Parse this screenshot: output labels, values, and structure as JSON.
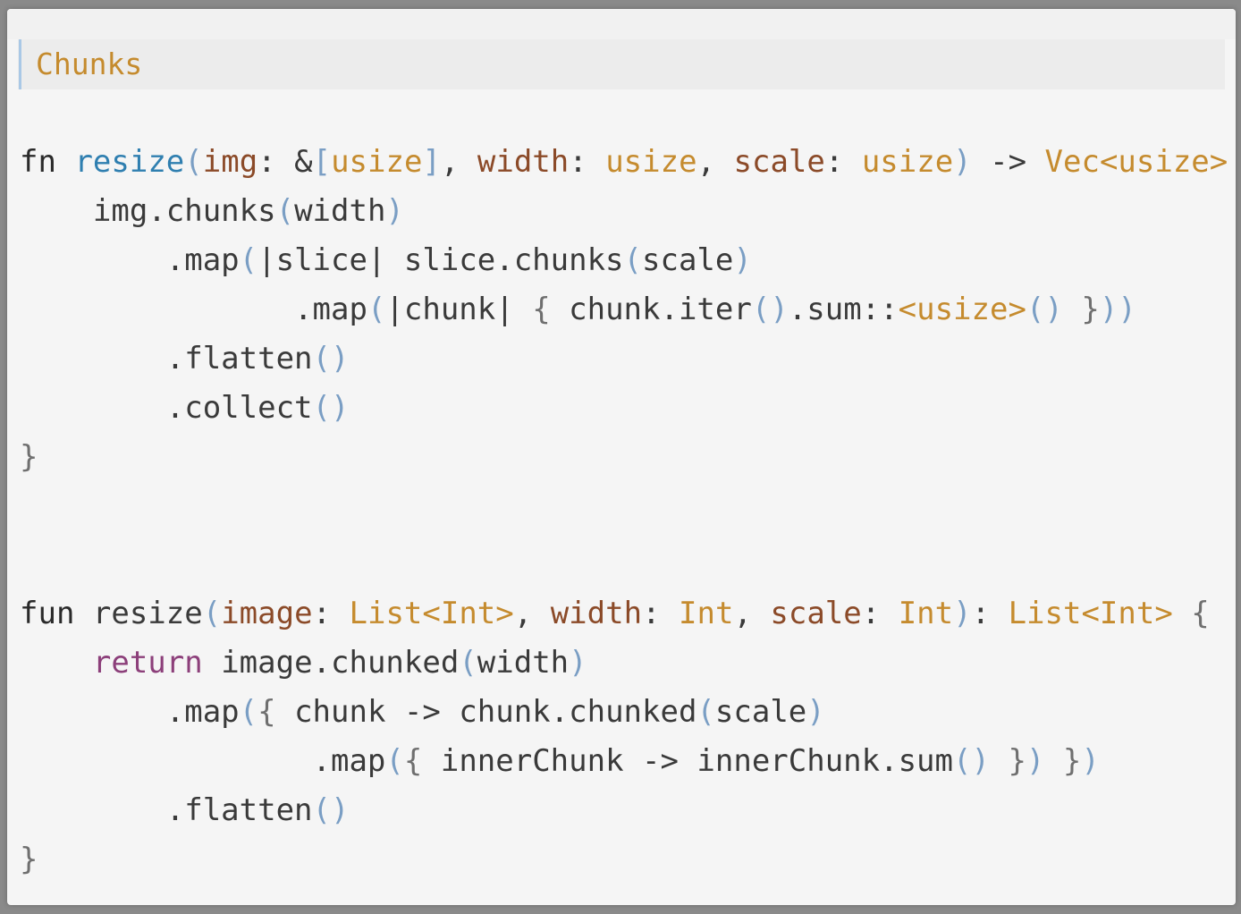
{
  "slide": {
    "title": "Chunks"
  },
  "rust_code": {
    "lines": [
      {
        "tokens": [
          {
            "t": "fn",
            "c": "kw"
          },
          {
            "t": " "
          },
          {
            "t": "resize",
            "c": "fnn"
          },
          {
            "t": "(",
            "c": "pa"
          },
          {
            "t": "img",
            "c": "pr"
          },
          {
            "t": ": &"
          },
          {
            "t": "[",
            "c": "pa"
          },
          {
            "t": "usize",
            "c": "ty"
          },
          {
            "t": "]",
            "c": "pa"
          },
          {
            "t": ", "
          },
          {
            "t": "width",
            "c": "pr"
          },
          {
            "t": ": "
          },
          {
            "t": "usize",
            "c": "ty"
          },
          {
            "t": ", "
          },
          {
            "t": "scale",
            "c": "pr"
          },
          {
            "t": ": "
          },
          {
            "t": "usize",
            "c": "ty"
          },
          {
            "t": ")",
            "c": "pa"
          },
          {
            "t": " -> "
          },
          {
            "t": "Vec<usize>",
            "c": "ty"
          },
          {
            "t": " "
          },
          {
            "t": "{",
            "c": "br"
          }
        ]
      },
      {
        "tokens": [
          {
            "t": "    img.chunks"
          },
          {
            "t": "(",
            "c": "pa"
          },
          {
            "t": "width"
          },
          {
            "t": ")",
            "c": "pa"
          }
        ]
      },
      {
        "tokens": [
          {
            "t": "        .map"
          },
          {
            "t": "(",
            "c": "pa"
          },
          {
            "t": "|slice| slice.chunks"
          },
          {
            "t": "(",
            "c": "pa"
          },
          {
            "t": "scale"
          },
          {
            "t": ")",
            "c": "pa"
          }
        ]
      },
      {
        "tokens": [
          {
            "t": "               .map"
          },
          {
            "t": "(",
            "c": "pa"
          },
          {
            "t": "|chunk| "
          },
          {
            "t": "{",
            "c": "br"
          },
          {
            "t": " chunk.iter"
          },
          {
            "t": "()",
            "c": "pa"
          },
          {
            "t": ".sum::"
          },
          {
            "t": "<usize>",
            "c": "ty"
          },
          {
            "t": "()",
            "c": "pa"
          },
          {
            "t": " "
          },
          {
            "t": "}",
            "c": "br"
          },
          {
            "t": "))",
            "c": "pa"
          }
        ]
      },
      {
        "tokens": [
          {
            "t": "        .flatten"
          },
          {
            "t": "()",
            "c": "pa"
          }
        ]
      },
      {
        "tokens": [
          {
            "t": "        .collect"
          },
          {
            "t": "()",
            "c": "pa"
          }
        ]
      },
      {
        "tokens": [
          {
            "t": "}",
            "c": "br"
          }
        ]
      }
    ]
  },
  "kotlin_code": {
    "lines": [
      {
        "tokens": [
          {
            "t": "fun",
            "c": "kw"
          },
          {
            "t": " resize"
          },
          {
            "t": "(",
            "c": "pa"
          },
          {
            "t": "image",
            "c": "pr"
          },
          {
            "t": ": "
          },
          {
            "t": "List<Int>",
            "c": "ty"
          },
          {
            "t": ", "
          },
          {
            "t": "width",
            "c": "pr"
          },
          {
            "t": ": "
          },
          {
            "t": "Int",
            "c": "ty"
          },
          {
            "t": ", "
          },
          {
            "t": "scale",
            "c": "pr"
          },
          {
            "t": ": "
          },
          {
            "t": "Int",
            "c": "ty"
          },
          {
            "t": ")",
            "c": "pa"
          },
          {
            "t": ": "
          },
          {
            "t": "List<Int>",
            "c": "ty"
          },
          {
            "t": " "
          },
          {
            "t": "{",
            "c": "br"
          }
        ]
      },
      {
        "tokens": [
          {
            "t": "    "
          },
          {
            "t": "return",
            "c": "ret"
          },
          {
            "t": " image.chunked"
          },
          {
            "t": "(",
            "c": "pa"
          },
          {
            "t": "width"
          },
          {
            "t": ")",
            "c": "pa"
          }
        ]
      },
      {
        "tokens": [
          {
            "t": "        .map"
          },
          {
            "t": "(",
            "c": "pa"
          },
          {
            "t": "{",
            "c": "br"
          },
          {
            "t": " chunk -> chunk.chunked"
          },
          {
            "t": "(",
            "c": "pa"
          },
          {
            "t": "scale"
          },
          {
            "t": ")",
            "c": "pa"
          }
        ]
      },
      {
        "tokens": [
          {
            "t": "                .map"
          },
          {
            "t": "(",
            "c": "pa"
          },
          {
            "t": "{",
            "c": "br"
          },
          {
            "t": " innerChunk -> innerChunk.sum"
          },
          {
            "t": "()",
            "c": "pa"
          },
          {
            "t": " "
          },
          {
            "t": "}",
            "c": "br"
          },
          {
            "t": ")",
            "c": "pa"
          },
          {
            "t": " "
          },
          {
            "t": "}",
            "c": "br"
          },
          {
            "t": ")",
            "c": "pa"
          }
        ]
      },
      {
        "tokens": [
          {
            "t": "        .flatten"
          },
          {
            "t": "()",
            "c": "pa"
          }
        ]
      },
      {
        "tokens": [
          {
            "t": "}",
            "c": "br"
          }
        ]
      }
    ]
  }
}
